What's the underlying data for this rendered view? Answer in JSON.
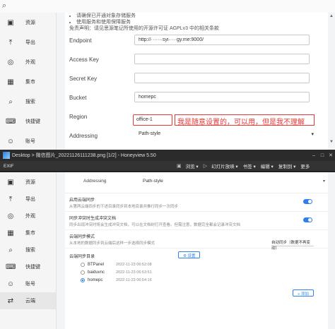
{
  "top": {
    "sidebar": [
      {
        "label": "资源",
        "icon": "image-icon"
      },
      {
        "label": "导出",
        "icon": "export-icon"
      },
      {
        "label": "外观",
        "icon": "palette-icon"
      },
      {
        "label": "集市",
        "icon": "shop-icon"
      },
      {
        "label": "搜索",
        "icon": "search-icon"
      },
      {
        "label": "快捷键",
        "icon": "keyboard-icon"
      },
      {
        "label": "账号",
        "icon": "account-icon"
      }
    ],
    "bullets": [
      "请确保已开通对象存储服务",
      "使用服务和使用保障服务"
    ],
    "disclaimer": "免责声明：请见思源笔记所使用的开源许可证 AGPLv3 中的相关条款",
    "fields": {
      "endpoint_label": "Endpoint",
      "endpoint_value": "http://·······syi·····gy.me:9000/",
      "access_key_label": "Access Key",
      "secret_key_label": "Secret Key",
      "bucket_label": "Bucket",
      "bucket_value": "homepc",
      "region_label": "Region",
      "region_value": "office-1",
      "addressing_label": "Addressing",
      "addressing_value": "Path-style"
    },
    "annotation": "我是随意设置的，可以用，但是我不理解"
  },
  "viewer": {
    "title": "Desktop > 微信图片_20221126111238.png [1/2] - Honeyview 5.50",
    "toolbar": {
      "exif": "EXIF",
      "browse": "浏览 ▾",
      "slideshow": "幻灯片放映 ▾",
      "bookmark": "书签 ▾",
      "edit": "编辑 ▾",
      "copy": "复制到 ▾",
      "more": "更多"
    }
  },
  "bottom": {
    "sidebar": [
      {
        "label": "资源",
        "icon": "image-icon"
      },
      {
        "label": "导出",
        "icon": "export-icon"
      },
      {
        "label": "外观",
        "icon": "palette-icon"
      },
      {
        "label": "集市",
        "icon": "shop-icon"
      },
      {
        "label": "搜索",
        "icon": "search-icon"
      },
      {
        "label": "快捷键",
        "icon": "keyboard-icon"
      },
      {
        "label": "账号",
        "icon": "account-icon"
      },
      {
        "label": "云端",
        "icon": "cloud-icon"
      }
    ],
    "addressing_label": "Addressing",
    "addressing_value": "Path-style",
    "sync_enable_title": "启用云端同步",
    "sync_enable_desc": "从第两云端同步的下述目录同步到本地目录并推行同步一次同步",
    "conflict_title": "同步冲突时生成冲突文档",
    "conflict_desc": "同步出现冲突时将会生成冲突文档，可以在文档树打开查看。但需注意，数据完全都会记录冲突文档",
    "mode_title": "云端同步模式",
    "mode_desc": "从本地的数据同步到云端后这样一步选择同步模式",
    "mode_value": "自动同步（数据不再变动）",
    "dirs_title": "云端同步目录",
    "settings_button": "⚙ 设置",
    "dirs": [
      {
        "name": "BTPanel",
        "date": "2022-11-23 06:52:08",
        "selected": false
      },
      {
        "name": "baiduvnc",
        "date": "2022-11-23 06:53:51",
        "selected": false
      },
      {
        "name": "homepc",
        "date": "2022-11-23 06:54:16",
        "selected": true
      }
    ],
    "add_button": "+ 添加"
  }
}
